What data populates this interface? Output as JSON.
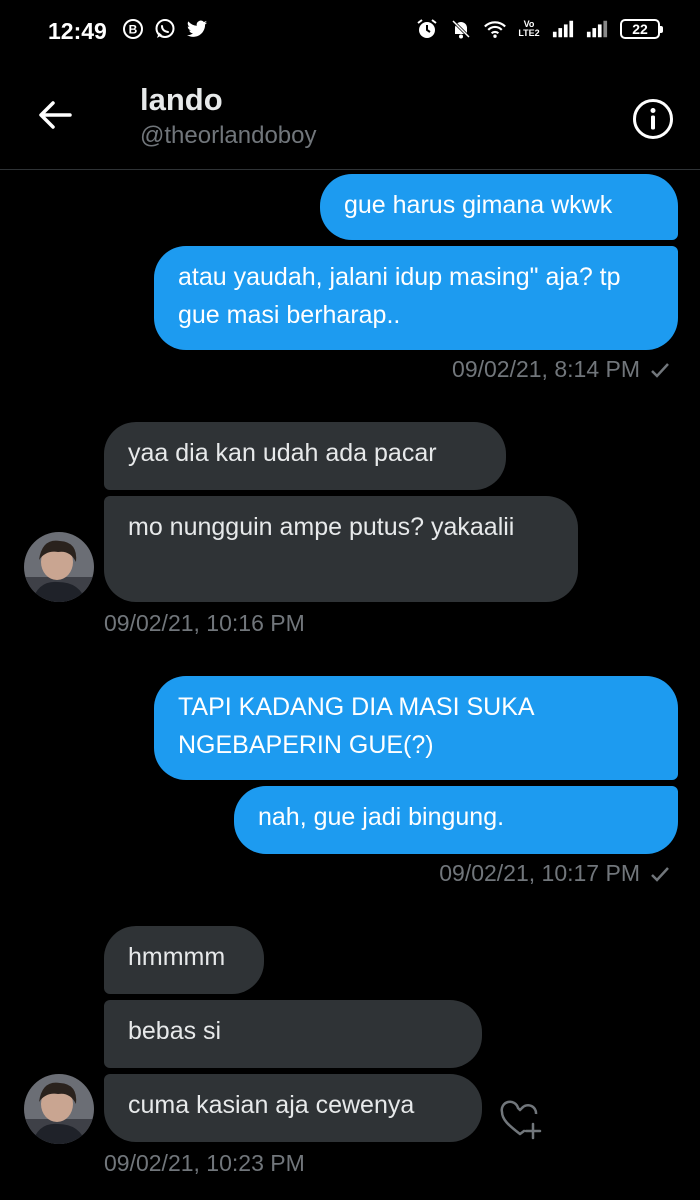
{
  "status_bar": {
    "time": "12:49",
    "battery": "22"
  },
  "conversation": {
    "name": "lando",
    "handle": "@theorlandoboy"
  },
  "icons": {
    "back": "arrow-left-icon",
    "info": "info-icon",
    "delivered": "checkmark-icon",
    "react": "heart-plus-icon"
  },
  "colors": {
    "sent_bubble": "#1d9bf0",
    "received_bubble": "#2f3336",
    "background": "#000000",
    "muted_text": "#71767b"
  },
  "messages": [
    {
      "direction": "sent",
      "text": "gue harus gimana wkwk"
    },
    {
      "direction": "sent",
      "text": "atau yaudah, jalani idup masing\" aja? tp gue masi berharap.."
    },
    {
      "direction": "received",
      "text": "yaa dia kan udah ada pacar"
    },
    {
      "direction": "received",
      "text": "mo nungguin ampe putus? yakaalii"
    },
    {
      "direction": "sent",
      "text": "TAPI KADANG DIA MASI SUKA NGEBAPERIN GUE(?)"
    },
    {
      "direction": "sent",
      "text": "nah, gue jadi bingung."
    },
    {
      "direction": "received",
      "text": "hmmmm"
    },
    {
      "direction": "received",
      "text": "bebas si"
    },
    {
      "direction": "received",
      "text": "cuma kasian aja cewenya"
    }
  ],
  "timestamps": [
    "09/02/21, 8:14 PM",
    "09/02/21, 10:16 PM",
    "09/02/21, 10:17 PM",
    "09/02/21, 10:23 PM"
  ]
}
